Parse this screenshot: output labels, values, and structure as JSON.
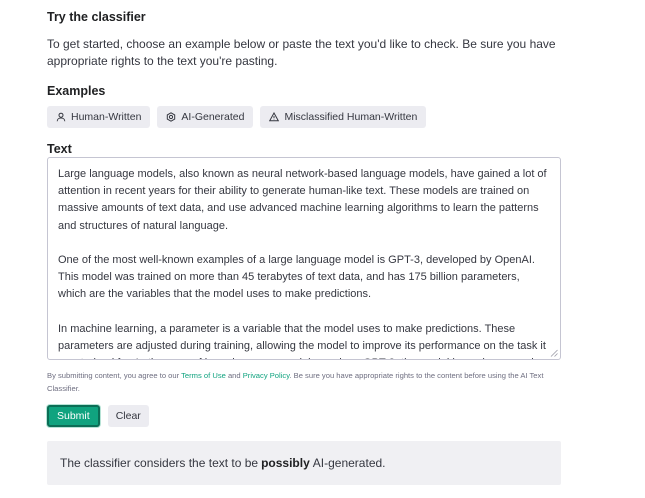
{
  "section_title": "Try the classifier",
  "intro": "To get started, choose an example below or paste the text you'd like to check. Be sure you have appropriate rights to the text you're pasting.",
  "examples": {
    "title": "Examples",
    "items": [
      {
        "label": "Human-Written",
        "icon": "person-icon"
      },
      {
        "label": "AI-Generated",
        "icon": "openai-logo-icon"
      },
      {
        "label": "Misclassified Human-Written",
        "icon": "warning-icon"
      }
    ]
  },
  "text_section": {
    "title": "Text",
    "paragraphs": [
      "Large language models, also known as neural network-based language models, have gained a lot of attention in recent years for their ability to generate human-like text. These models are trained on massive amounts of text data, and use advanced machine learning algorithms to learn the patterns and structures of natural language.",
      "One of the most well-known examples of a large language model is GPT-3, developed by OpenAI. This model was trained on more than 45 terabytes of text data, and has 175 billion parameters, which are the variables that the model uses to make predictions.",
      "In machine learning, a parameter is a variable that the model uses to make predictions. These parameters are adjusted during training, allowing the model to improve its performance on the task it was trained for. In the case of large language models, such as GPT-3, the model has a large number of parameters, often in"
    ]
  },
  "fine_print": {
    "before": "By submitting content, you agree to our ",
    "terms": "Terms of Use",
    "and": " and ",
    "privacy": "Privacy Policy",
    "after": ". Be sure you have appropriate rights to the content before using the AI Text Classifier."
  },
  "buttons": {
    "submit": "Submit",
    "clear": "Clear"
  },
  "result": {
    "before": "The classifier considers the text to be",
    "emphasis": "possibly",
    "after": "AI-generated."
  },
  "colors": {
    "accent": "#10a37f",
    "chip_bg": "#ececf1",
    "result_bg": "#f0f0f3"
  }
}
